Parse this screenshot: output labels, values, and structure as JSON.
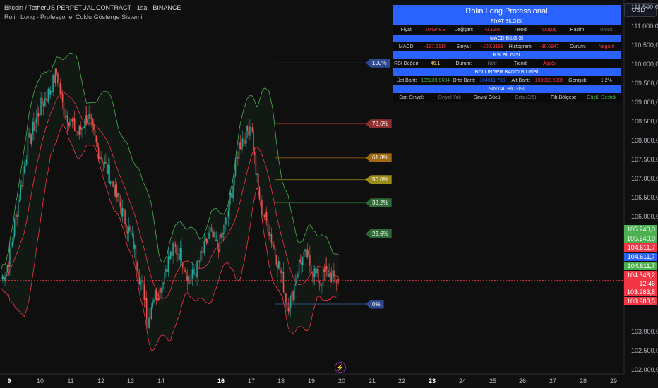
{
  "header": {
    "title": "Bitcoin / TetherUS PERPETUAL CONTRACT · 1sa · BINANCE",
    "subtitle": "Rolin Long - Profesyonel Çoklu Gösterge Sistemi",
    "currency_button": "USDT"
  },
  "price_axis": [
    "111.500,0",
    "111.000,0",
    "110.500,0",
    "110.000,0",
    "109.500,0",
    "109.000,0",
    "108.500,0",
    "108.000,0",
    "107.500,0",
    "107.000,0",
    "106.500,0",
    "106.000,0",
    "103.000,0",
    "102.500,0",
    "102.000,0"
  ],
  "price_badges": [
    {
      "label": "105.240,0",
      "color": "#4caf50"
    },
    {
      "label": "105.240,0",
      "color": "#4caf50"
    },
    {
      "label": "104.611,7",
      "color": "#f23645"
    },
    {
      "label": "104.611,7",
      "color": "#2962ff"
    },
    {
      "label": "104.611,7",
      "color": "#4caf50"
    },
    {
      "label": "104.348,2",
      "color": "#f23645"
    },
    {
      "label": "12:46",
      "color": "#f23645"
    },
    {
      "label": "103.983,5",
      "color": "#f23645"
    },
    {
      "label": "103.983,5",
      "color": "#f23645"
    }
  ],
  "time_axis": [
    {
      "label": "9",
      "bold": true
    },
    {
      "label": "10"
    },
    {
      "label": "11"
    },
    {
      "label": "12"
    },
    {
      "label": "13"
    },
    {
      "label": "14"
    },
    {
      "label": "16",
      "bold": true
    },
    {
      "label": "17"
    },
    {
      "label": "18"
    },
    {
      "label": "19"
    },
    {
      "label": "20"
    },
    {
      "label": "21"
    },
    {
      "label": "22"
    },
    {
      "label": "23",
      "bold": true
    },
    {
      "label": "24"
    },
    {
      "label": "25"
    },
    {
      "label": "26"
    },
    {
      "label": "27"
    },
    {
      "label": "28"
    },
    {
      "label": "29"
    }
  ],
  "fib_levels": [
    {
      "label": "100%",
      "color": "#2e4a8f"
    },
    {
      "label": "78.6%",
      "color": "#8e2f2f"
    },
    {
      "label": "61.8%",
      "color": "#a06a12"
    },
    {
      "label": "50.0%",
      "color": "#9c8c16"
    },
    {
      "label": "38.2%",
      "color": "#2d6b34"
    },
    {
      "label": "23.6%",
      "color": "#2d6b34"
    },
    {
      "label": "0%",
      "color": "#2e4a8f"
    }
  ],
  "info_panel": {
    "title": "Rolin Long Professional",
    "price_section": "FİYAT BİLGİSİ",
    "price_row": {
      "price_label": "Fiyat:",
      "price_value": "104348.3",
      "change_label": "Değişim:",
      "change_value": "-0.13%",
      "trend_label": "Trend:",
      "trend_value": "Düşüş",
      "volume_label": "Hacim:",
      "volume_value": "0.68x"
    },
    "macd_section": "MACD BİLGİSİ",
    "macd_row": {
      "macd_label": "MACD:",
      "macd_value": "-137.6115",
      "signal_label": "Sinyal:",
      "signal_value": "-100.9168",
      "hist_label": "Histogram:",
      "hist_value": "-36.6947",
      "status_label": "Durum:",
      "status_value": "Negatif"
    },
    "rsi_section": "RSI BİLGİSİ",
    "rsi_row": {
      "rsi_label": "RSI Değeri:",
      "rsi_value": "46.1",
      "status_label": "Durum:",
      "status_value": "Nötr",
      "trend_label": "Trend:",
      "trend_value": "Aşağı"
    },
    "bb_section": "BOLLINGER BANDI BİLGİSİ",
    "bb_row": {
      "upper_label": "Üst Bant:",
      "upper_value": "105239.9694",
      "mid_label": "Orta Bant:",
      "mid_value": "104611.735",
      "lower_label": "Alt Bant:",
      "lower_value": "103983.5006",
      "width_label": "Genişlik:",
      "width_value": "1.2%"
    },
    "signal_section": "SİNYAL BİLGİSİ",
    "signal_row": {
      "last_label": "Son Sinyal:",
      "last_value": "Sinyal Yok",
      "strength_label": "Sinyal Gücü:",
      "strength_value": "Orta (3/5)",
      "fib_label": "Fib Bölgesi:",
      "fib_value": "Güçlü Destek"
    }
  },
  "chart_data": {
    "type": "candlestick",
    "symbol": "Bitcoin / TetherUS PERPETUAL CONTRACT",
    "timeframe": "1sa",
    "last_price": 104348.2,
    "bollinger": {
      "upper": 105240.0,
      "middle": 104611.7,
      "lower": 103983.5
    },
    "ylim": [
      101900,
      111700
    ],
    "fib_prices": [
      110050,
      108450,
      107560,
      106990,
      106380,
      105570,
      103730
    ],
    "close_path": [
      [
        0,
        104400
      ],
      [
        4,
        104600
      ],
      [
        8,
        105200
      ],
      [
        14,
        106400
      ],
      [
        22,
        107900
      ],
      [
        28,
        108500
      ],
      [
        34,
        109000
      ],
      [
        40,
        109300
      ],
      [
        46,
        109800
      ],
      [
        52,
        108800
      ],
      [
        58,
        108500
      ],
      [
        64,
        108200
      ],
      [
        72,
        108700
      ],
      [
        80,
        107800
      ],
      [
        90,
        107100
      ],
      [
        100,
        106200
      ],
      [
        110,
        105300
      ],
      [
        116,
        104300
      ],
      [
        120,
        103900
      ],
      [
        122,
        103200
      ],
      [
        126,
        103900
      ],
      [
        132,
        104100
      ],
      [
        138,
        104800
      ],
      [
        144,
        105200
      ],
      [
        150,
        105000
      ],
      [
        156,
        104300
      ],
      [
        162,
        104600
      ],
      [
        168,
        105100
      ],
      [
        174,
        105600
      ],
      [
        180,
        105200
      ],
      [
        186,
        105700
      ],
      [
        192,
        106700
      ],
      [
        198,
        107900
      ],
      [
        204,
        108200
      ],
      [
        208,
        108500
      ],
      [
        212,
        107200
      ],
      [
        216,
        106300
      ],
      [
        222,
        105800
      ],
      [
        228,
        105100
      ],
      [
        234,
        104400
      ],
      [
        238,
        103700
      ],
      [
        242,
        103900
      ],
      [
        248,
        104800
      ],
      [
        254,
        105000
      ],
      [
        260,
        104600
      ],
      [
        266,
        104300
      ],
      [
        270,
        104600
      ],
      [
        276,
        104400
      ],
      [
        281,
        104348
      ]
    ]
  },
  "colors": {
    "up": "#26a69a",
    "down": "#ef5350",
    "accent": "#2962ff",
    "upper_band": "#4caf50",
    "lower_band": "#f23645"
  }
}
